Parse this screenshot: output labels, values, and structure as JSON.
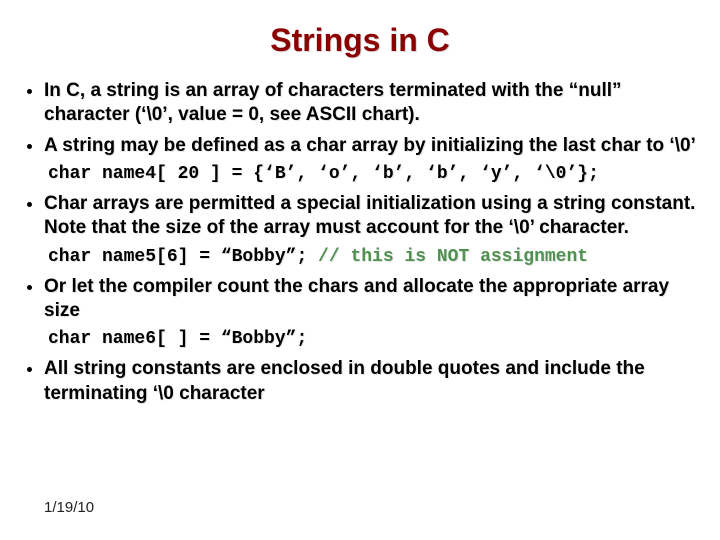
{
  "title": "Strings in C",
  "bullets": {
    "b1": "In C, a string is an array of characters terminated with the “null” character (‘\\0’, value = 0, see ASCII chart).",
    "b2": "A string may be defined as a char array by initializing the last char to ‘\\0’",
    "b3": "Char arrays are permitted a special initialization using a string constant.  Note that the size of the array must account for the ‘\\0’ character.",
    "b4": "Or let the compiler count the chars and allocate the appropriate array size",
    "b5": "All string constants are enclosed in double quotes and include the terminating ‘\\0 character"
  },
  "code": {
    "c1": "char name4[ 20 ] = {‘B’, ‘o’, ‘b’, ‘b’, ‘y’, ‘\\0’};",
    "c2_code": "char name5[6] = “Bobby”;   ",
    "c2_comment": "// this is NOT assignment",
    "c3": "char name6[ ] = “Bobby”;"
  },
  "footer": {
    "date": "1/19/10"
  }
}
